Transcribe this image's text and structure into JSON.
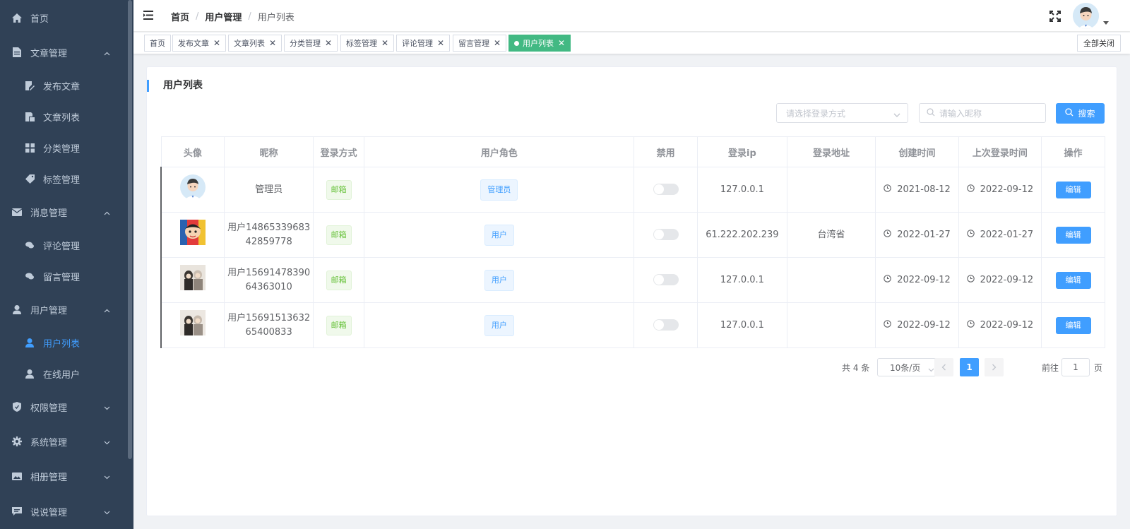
{
  "sidebar": {
    "items": [
      {
        "label": "首页",
        "icon": "home-icon",
        "level": "top"
      },
      {
        "label": "文章管理",
        "icon": "document-icon",
        "level": "top",
        "arrow": "up"
      },
      {
        "label": "发布文章",
        "icon": "edit-icon",
        "level": "sub"
      },
      {
        "label": "文章列表",
        "icon": "list-icon",
        "level": "sub"
      },
      {
        "label": "分类管理",
        "icon": "grid-icon",
        "level": "sub"
      },
      {
        "label": "标签管理",
        "icon": "tag-icon",
        "level": "sub"
      },
      {
        "label": "消息管理",
        "icon": "mail-icon",
        "level": "top",
        "arrow": "up"
      },
      {
        "label": "评论管理",
        "icon": "comment-icon",
        "level": "sub"
      },
      {
        "label": "留言管理",
        "icon": "chat-icon",
        "level": "sub"
      },
      {
        "label": "用户管理",
        "icon": "user-icon",
        "level": "top",
        "arrow": "up"
      },
      {
        "label": "用户列表",
        "icon": "user-icon",
        "level": "sub",
        "active": true
      },
      {
        "label": "在线用户",
        "icon": "user-icon",
        "level": "sub"
      },
      {
        "label": "权限管理",
        "icon": "shield-icon",
        "level": "top",
        "arrow": "down"
      },
      {
        "label": "系统管理",
        "icon": "gear-icon",
        "level": "top",
        "arrow": "down"
      },
      {
        "label": "相册管理",
        "icon": "image-icon",
        "level": "top",
        "arrow": "down"
      },
      {
        "label": "说说管理",
        "icon": "talk-icon",
        "level": "top",
        "arrow": "down"
      }
    ]
  },
  "header": {
    "breadcrumb": [
      "首页",
      "用户管理",
      "用户列表"
    ]
  },
  "tags": {
    "items": [
      "首页",
      "发布文章",
      "文章列表",
      "分类管理",
      "标签管理",
      "评论管理",
      "留言管理",
      "用户列表"
    ],
    "active": "用户列表",
    "close_all": "全部关闭"
  },
  "card": {
    "title": "用户列表",
    "login_select_placeholder": "请选择登录方式",
    "search_placeholder": "请输入昵称",
    "search_button": "搜索"
  },
  "table": {
    "headers": [
      "头像",
      "昵称",
      "登录方式",
      "用户角色",
      "禁用",
      "登录ip",
      "登录地址",
      "创建时间",
      "上次登录时间",
      "操作"
    ],
    "rows": [
      {
        "nickname_1": "管理员",
        "nickname_2": "",
        "login": "邮箱",
        "role": "管理员",
        "disabled": false,
        "ip": "127.0.0.1",
        "address": "",
        "created": "2021-08-12",
        "last_login": "2022-09-12",
        "action": "编辑"
      },
      {
        "nickname_1": "用户14865339683",
        "nickname_2": "42859778",
        "login": "邮箱",
        "role": "用户",
        "disabled": false,
        "ip": "61.222.202.239",
        "address": "台湾省",
        "created": "2022-01-27",
        "last_login": "2022-01-27",
        "action": "编辑"
      },
      {
        "nickname_1": "用户15691478390",
        "nickname_2": "64363010",
        "login": "邮箱",
        "role": "用户",
        "disabled": false,
        "ip": "127.0.0.1",
        "address": "",
        "created": "2022-09-12",
        "last_login": "2022-09-12",
        "action": "编辑"
      },
      {
        "nickname_1": "用户15691513632",
        "nickname_2": "65400833",
        "login": "邮箱",
        "role": "用户",
        "disabled": false,
        "ip": "127.0.0.1",
        "address": "",
        "created": "2022-09-12",
        "last_login": "2022-09-12",
        "action": "编辑"
      }
    ]
  },
  "pagination": {
    "total": "共 4 条",
    "page_size": "10条/页",
    "current_page": "1",
    "goto_label": "前往",
    "goto_value": "1",
    "page_suffix": "页"
  },
  "colors": {
    "sidebar_bg": "#304156",
    "sidebar_text": "#bfcbd9",
    "accent": "#409eff",
    "tag_active": "#42b983"
  }
}
